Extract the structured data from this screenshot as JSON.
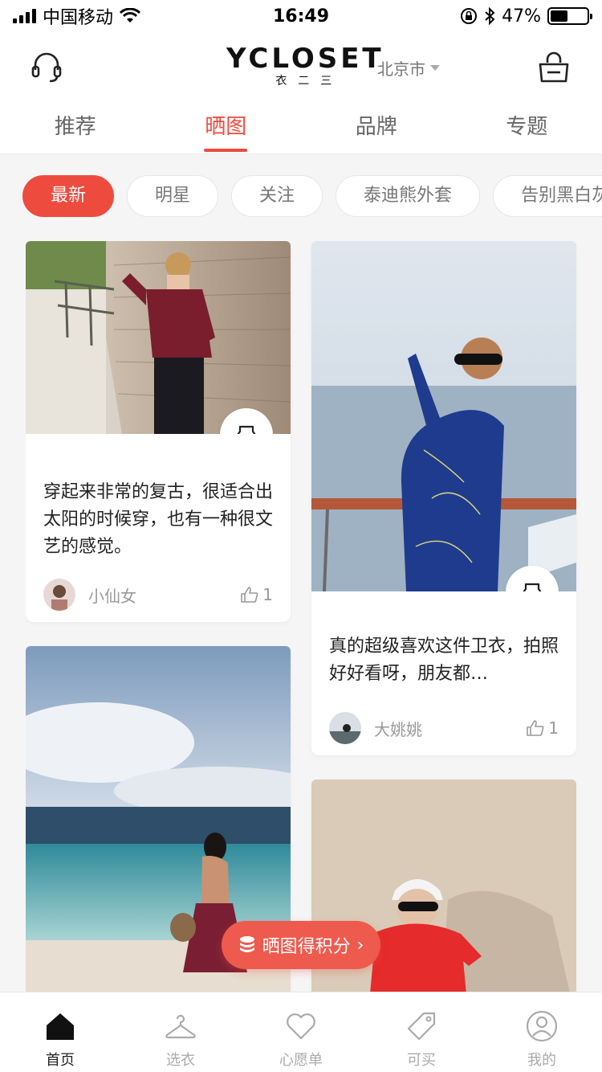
{
  "status_bar": {
    "carrier": "中国移动",
    "time": "16:49",
    "battery": "47%",
    "battery_level": 0.47
  },
  "header": {
    "logo": "YCLOSET",
    "logo_sub": "衣二三",
    "city": "北京市"
  },
  "tabs": [
    {
      "label": "推荐",
      "active": false
    },
    {
      "label": "晒图",
      "active": true
    },
    {
      "label": "品牌",
      "active": false
    },
    {
      "label": "专题",
      "active": false
    }
  ],
  "chips": [
    {
      "label": "最新",
      "active": true
    },
    {
      "label": "明星"
    },
    {
      "label": "关注"
    },
    {
      "label": "泰迪熊外套"
    },
    {
      "label": "告别黑白灰"
    }
  ],
  "posts": [
    {
      "text": "穿起来非常的复古，很适合出太阳的时候穿，也有一种很文艺的感觉。",
      "author": "小仙女",
      "likes": "1"
    },
    {
      "text": "真的超级喜欢这件卫衣，拍照好好看呀，朋友都…",
      "author": "大姚姚",
      "likes": "1"
    }
  ],
  "float_button": {
    "label": "晒图得积分"
  },
  "bottom_nav": [
    {
      "label": "首页",
      "icon": "home-icon",
      "active": true
    },
    {
      "label": "选衣",
      "icon": "hanger-icon"
    },
    {
      "label": "心愿单",
      "icon": "heart-icon"
    },
    {
      "label": "可买",
      "icon": "tag-icon"
    },
    {
      "label": "我的",
      "icon": "profile-icon"
    }
  ],
  "colors": {
    "accent": "#ee4b3f"
  }
}
